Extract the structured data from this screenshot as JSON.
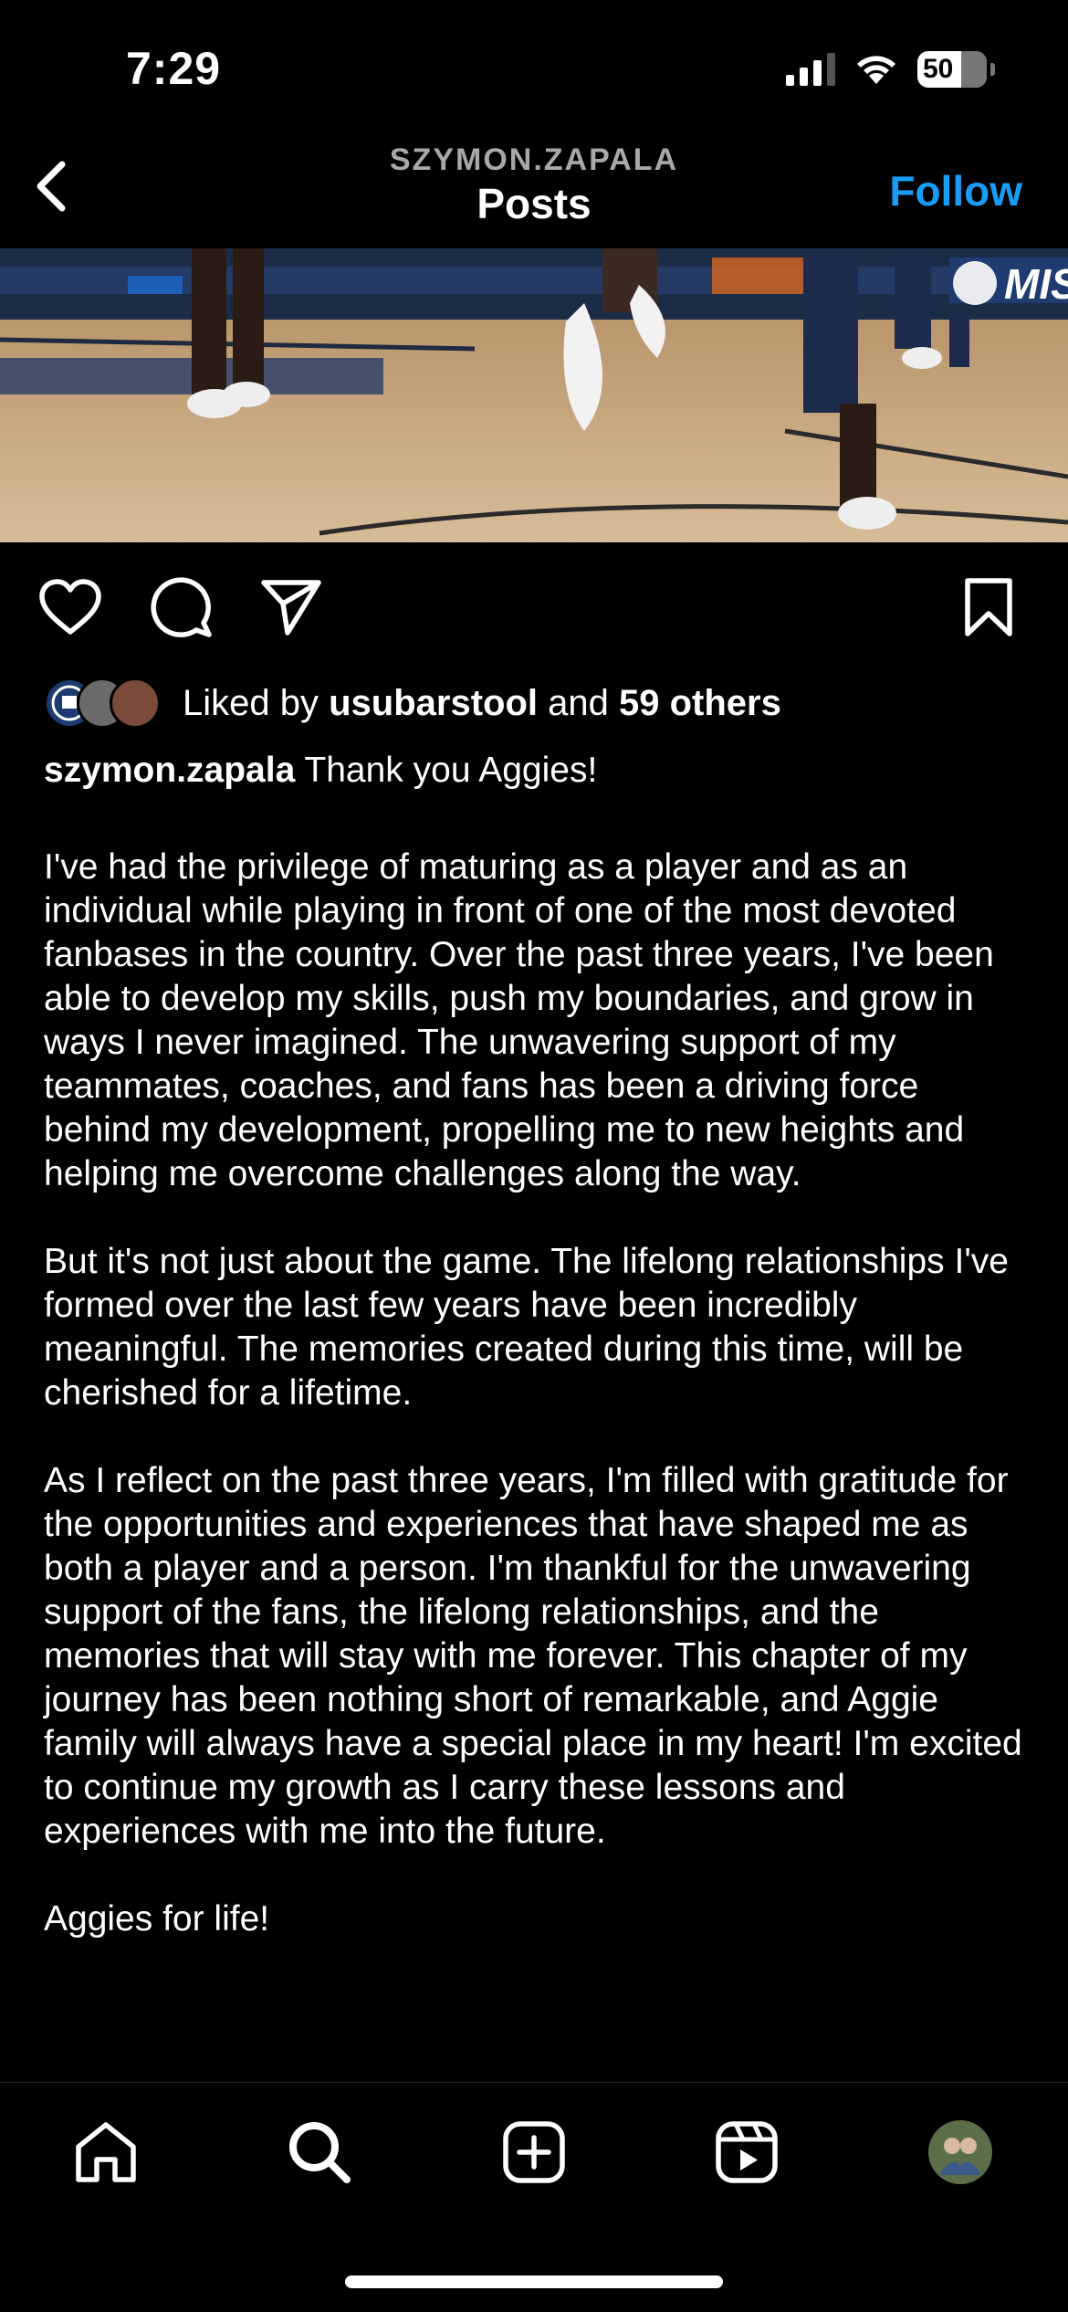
{
  "status_bar": {
    "time": "7:29",
    "battery": "50"
  },
  "header": {
    "username": "SZYMON.ZAPALA",
    "title": "Posts",
    "follow_label": "Follow"
  },
  "post": {
    "image_icon": "basketball-court-photo",
    "likes": {
      "prefix": "Liked by ",
      "user": "usubarstool",
      "conjunction": " and ",
      "others": "59 others"
    },
    "caption": {
      "author": "szymon.zapala",
      "first_line": " Thank you Aggies!",
      "paragraphs": [
        "I've had the privilege of maturing as a player and as an individual while playing in front of one of the most devoted fanbases in the country. Over the past three years, I've been able to develop my skills, push my boundaries, and grow in ways I never imagined. The unwavering support of my teammates, coaches, and fans has been a driving force behind my development, propelling me to new heights and helping me overcome challenges along the way.",
        "But it's not just about the game. The lifelong relationships I've formed over the last few years have been incredibly meaningful. The memories created during this time, will be cherished for a lifetime.",
        "As I reflect on the past three years, I'm filled with gratitude for the opportunities and experiences that have shaped me as both a player and a person. I'm thankful for the unwavering support of the fans, the lifelong relationships, and the memories that will stay with me forever. This chapter of my journey has been nothing short of remarkable, and Aggie family will always have a special place in my heart! I'm excited to continue my growth as I carry these lessons and experiences with me into the future.",
        "Aggies for life!"
      ]
    }
  },
  "colors": {
    "background": "#000000",
    "accent": "#1a9cf6",
    "muted": "#a8a8a8"
  },
  "icons": {
    "back": "chevron-left-icon",
    "like": "heart-icon",
    "comment": "comment-icon",
    "share": "paper-plane-icon",
    "save": "bookmark-icon",
    "tabs": [
      "home-icon",
      "search-icon",
      "create-icon",
      "reels-icon",
      "profile-avatar"
    ]
  }
}
